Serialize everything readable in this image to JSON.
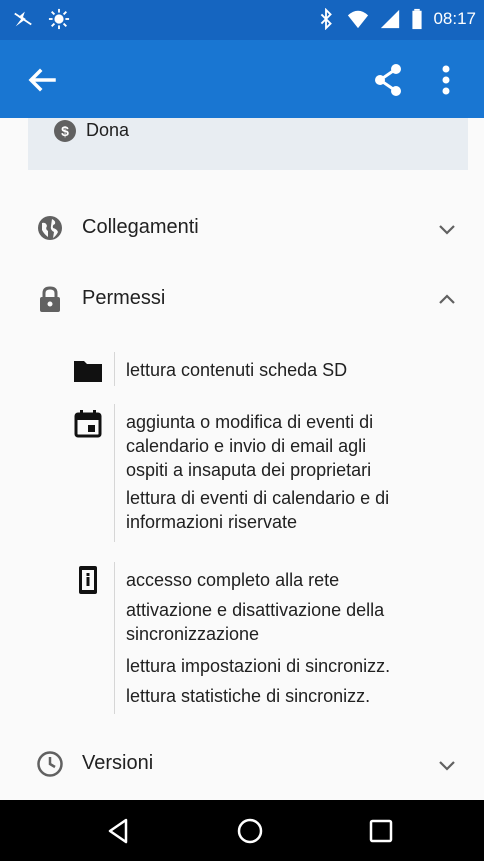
{
  "status_bar": {
    "time": "08:17",
    "left_icons": [
      "notification-icon",
      "brightness-icon"
    ],
    "right_icons": [
      "bluetooth-icon",
      "wifi-icon",
      "cell-signal-icon",
      "battery-icon"
    ]
  },
  "app_bar": {
    "back_icon": "arrow-back-icon",
    "share_icon": "share-icon",
    "more_icon": "more-vert-icon"
  },
  "donate": {
    "coin_symbol": "$",
    "label": "Dona"
  },
  "sections": {
    "links": {
      "label": "Collegamenti",
      "icon": "globe-icon",
      "chevron": "chevron-down-icon"
    },
    "permissions": {
      "label": "Permessi",
      "icon": "lock-icon",
      "chevron": "chevron-up-icon"
    },
    "versions": {
      "label": "Versioni",
      "icon": "clock-icon",
      "chevron": "chevron-down-icon"
    }
  },
  "permission_groups": [
    {
      "icon": "folder-icon",
      "lines": [
        "lettura contenuti scheda SD"
      ]
    },
    {
      "icon": "calendar-icon",
      "lines": [
        "aggiunta o modifica di eventi di",
        "calendario e invio di email agli",
        "ospiti a insaputa dei proprietari",
        "lettura di eventi di calendario e di",
        "informazioni riservate"
      ]
    },
    {
      "icon": "device-info-icon",
      "lines": [
        "accesso completo alla rete",
        "attivazione e disattivazione della",
        "sincronizzazione",
        "lettura impostazioni di sincronizz.",
        "lettura statistiche di sincronizz."
      ]
    }
  ],
  "nav_bar": {
    "back": "nav-back-icon",
    "home": "nav-home-icon",
    "recents": "nav-recents-icon"
  },
  "colors": {
    "status_bar": "#1565c0",
    "app_bar": "#1976d2",
    "background": "#fafafa",
    "card": "#e8edf2",
    "icon": "#616161"
  }
}
